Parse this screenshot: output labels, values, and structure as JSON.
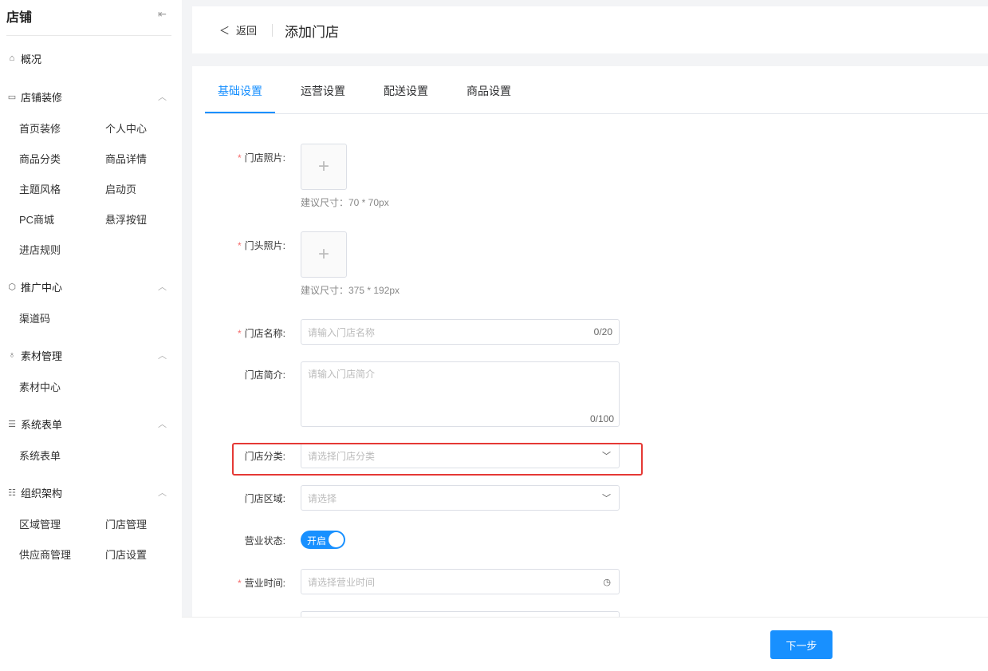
{
  "sidebar": {
    "title": "店铺",
    "collapse_icon": "collapse-left-icon",
    "overview": "概况",
    "groups": [
      {
        "label": "店铺装修",
        "items": [
          "首页装修",
          "个人中心",
          "商品分类",
          "商品详情",
          "主题风格",
          "启动页",
          "PC商城",
          "悬浮按钮",
          "进店规则"
        ]
      },
      {
        "label": "推广中心",
        "items": [
          "渠道码"
        ]
      },
      {
        "label": "素材管理",
        "items": [
          "素材中心"
        ]
      },
      {
        "label": "系统表单",
        "items": [
          "系统表单"
        ]
      },
      {
        "label": "组织架构",
        "items": [
          "区域管理",
          "门店管理",
          "供应商管理",
          "门店设置"
        ]
      }
    ]
  },
  "header": {
    "back_label": "返回",
    "title": "添加门店"
  },
  "tabs": [
    "基础设置",
    "运营设置",
    "配送设置",
    "商品设置"
  ],
  "form": {
    "store_photo": {
      "label": "门店照片:",
      "hint": "建议尺寸：70 * 70px"
    },
    "front_photo": {
      "label": "门头照片:",
      "hint": "建议尺寸：375 * 192px"
    },
    "store_name": {
      "label": "门店名称:",
      "placeholder": "请输入门店名称",
      "count": "0/20"
    },
    "store_intro": {
      "label": "门店简介:",
      "placeholder": "请输入门店简介",
      "count": "0/100"
    },
    "store_category": {
      "label": "门店分类:",
      "placeholder": "请选择门店分类"
    },
    "store_region": {
      "label": "门店区域:",
      "placeholder": "请选择"
    },
    "business_status": {
      "label": "营业状态:",
      "switch_text": "开启",
      "on": true
    },
    "business_hours": {
      "label": "营业时间:",
      "placeholder": "请选择营业时间"
    }
  },
  "footer": {
    "next_label": "下一步"
  },
  "colors": {
    "accent": "#1890ff",
    "required": "#f56c6c",
    "highlight": "#e53935"
  }
}
